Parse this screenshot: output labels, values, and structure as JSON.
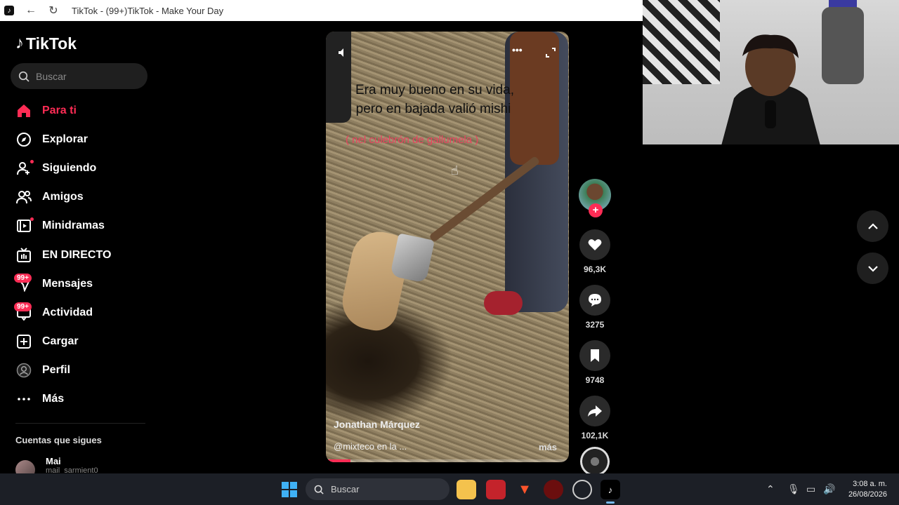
{
  "browser": {
    "title": "TikTok - (99+)TikTok - Make Your Day"
  },
  "sidebar": {
    "logo": "TikTok",
    "search_placeholder": "Buscar",
    "items": [
      {
        "label": "Para ti",
        "icon": "home-icon",
        "active": true
      },
      {
        "label": "Explorar",
        "icon": "compass-icon"
      },
      {
        "label": "Siguiendo",
        "icon": "following-icon"
      },
      {
        "label": "Amigos",
        "icon": "friends-icon"
      },
      {
        "label": "Minidramas",
        "icon": "film-icon"
      },
      {
        "label": "EN DIRECTO",
        "icon": "live-icon"
      },
      {
        "label": "Mensajes",
        "icon": "messages-icon",
        "badge": "99+"
      },
      {
        "label": "Actividad",
        "icon": "activity-icon",
        "badge": "99+"
      },
      {
        "label": "Cargar",
        "icon": "upload-icon"
      },
      {
        "label": "Perfil",
        "icon": "profile-icon"
      },
      {
        "label": "Más",
        "icon": "more-icon"
      }
    ],
    "following_title": "Cuentas que sigues",
    "following": [
      {
        "name": "Mai",
        "handle": "mail_sarmient0"
      }
    ]
  },
  "video": {
    "caption_line1": "Era muy bueno en su vida,",
    "caption_line2": "pero en bajada valió mishi",
    "caption_line3": "( nel culebrón de gallumela )",
    "author": "Jonathan Márquez",
    "description": "@mixteco en la ...",
    "more_label": "más",
    "progress": 0.1
  },
  "actions": {
    "likes": "96,3K",
    "comments": "3275",
    "saves": "9748",
    "shares": "102,1K"
  },
  "taskbar": {
    "search_placeholder": "Buscar",
    "time": "3:08 a. m.",
    "date": "26/08/2026"
  },
  "colors": {
    "accent": "#fe2c55",
    "background": "#000000",
    "taskbar": "#1c1f26"
  }
}
